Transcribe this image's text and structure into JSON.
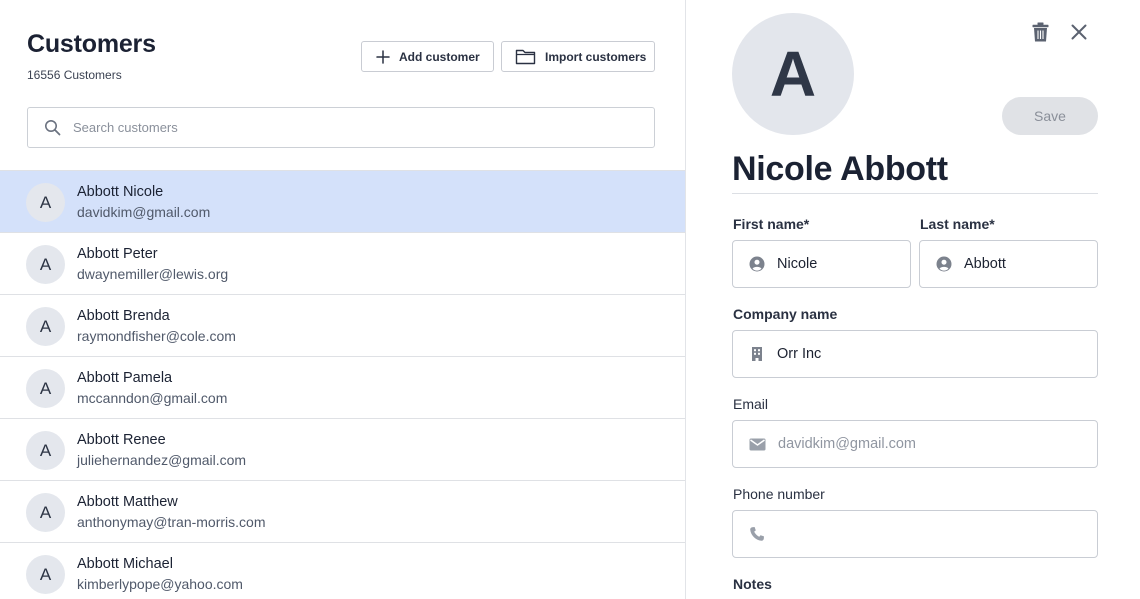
{
  "list": {
    "title": "Customers",
    "count_label": "16556 Customers",
    "add_label": "Add customer",
    "import_label": "Import customers",
    "search_placeholder": "Search customers",
    "customers": [
      {
        "initial": "A",
        "name": "Abbott Nicole",
        "email": "davidkim@gmail.com",
        "selected": true
      },
      {
        "initial": "A",
        "name": "Abbott Peter",
        "email": "dwaynemiller@lewis.org",
        "selected": false
      },
      {
        "initial": "A",
        "name": "Abbott Brenda",
        "email": "raymondfisher@cole.com",
        "selected": false
      },
      {
        "initial": "A",
        "name": "Abbott Pamela",
        "email": "mccanndon@gmail.com",
        "selected": false
      },
      {
        "initial": "A",
        "name": "Abbott Renee",
        "email": "juliehernandez@gmail.com",
        "selected": false
      },
      {
        "initial": "A",
        "name": "Abbott Matthew",
        "email": "anthonymay@tran-morris.com",
        "selected": false
      },
      {
        "initial": "A",
        "name": "Abbott Michael",
        "email": "kimberlypope@yahoo.com",
        "selected": false
      }
    ]
  },
  "detail": {
    "initial": "A",
    "full_name": "Nicole Abbott",
    "save_label": "Save",
    "first_name_label": "First name*",
    "first_name_value": "Nicole",
    "last_name_label": "Last name*",
    "last_name_value": "Abbott",
    "company_label": "Company name",
    "company_value": "Orr Inc",
    "email_label": "Email",
    "email_placeholder": "davidkim@gmail.com",
    "phone_label": "Phone number",
    "phone_value": "",
    "notes_label": "Notes"
  },
  "icons": {
    "add": "plus-icon",
    "import": "folder-icon",
    "search": "search-icon",
    "delete": "trash-icon",
    "close": "close-icon",
    "person": "person-icon",
    "company": "building-icon",
    "email": "envelope-icon",
    "phone": "phone-icon"
  },
  "colors": {
    "selected_row": "#d4e1fa",
    "avatar_bg": "#e4e7ed",
    "save_disabled_bg": "#e0e2e6"
  }
}
